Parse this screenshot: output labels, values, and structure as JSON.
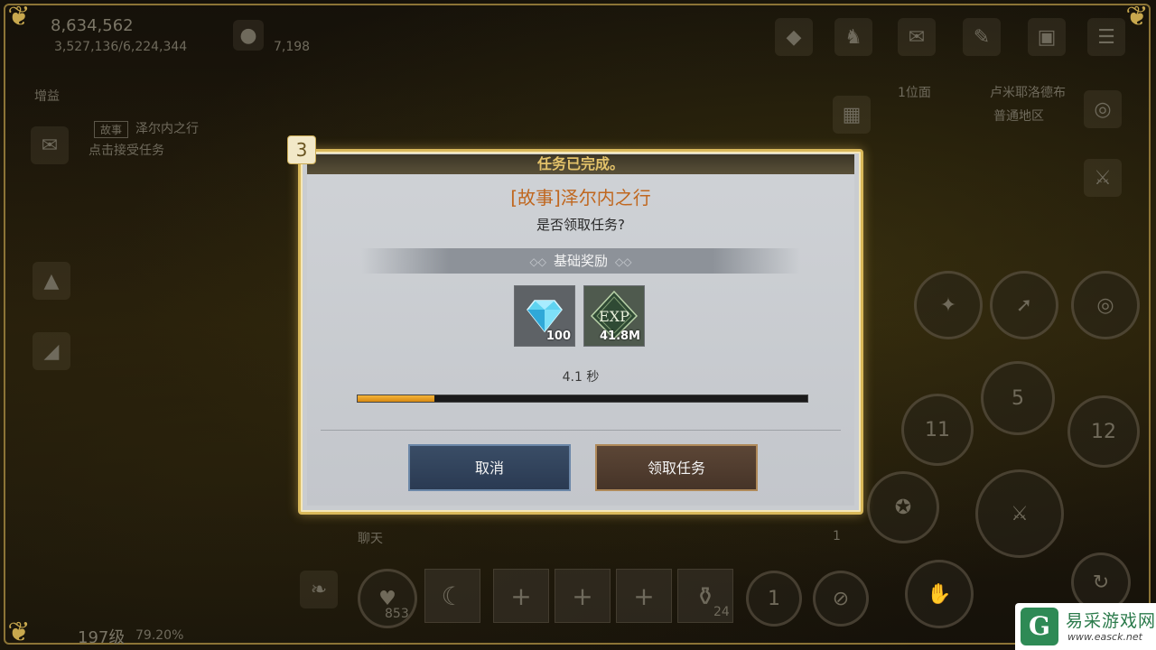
{
  "hud": {
    "power": "8,634,562",
    "exp": "3,527,136/6,224,344",
    "currency": "7,198",
    "buff_label": "增益",
    "quest_tag": "故事",
    "quest_name": "泽尔内之行",
    "quest_hint": "点击接受任务",
    "channel": "1位面",
    "location": "卢米耶洛德布",
    "area": "普通地区",
    "chat_label": "聊天",
    "level": "197级",
    "level_percent": "79.20%",
    "skill_numbers": [
      "5",
      "11",
      "12",
      "1",
      "1",
      "1"
    ],
    "slot_counts": [
      "853",
      "24"
    ]
  },
  "dialog": {
    "step": "3",
    "top_caption": "任务已完成。",
    "quest_title": "[故事]泽尔内之行",
    "question": "是否领取任务?",
    "reward_header": "基础奖励",
    "rewards": [
      {
        "icon": "diamond-icon",
        "qty": "100"
      },
      {
        "icon": "exp-icon",
        "label": "EXP",
        "qty": "41.8M"
      }
    ],
    "timer": "4.1 秒",
    "progress": 0.17,
    "cancel_label": "取消",
    "accept_label": "领取任务"
  },
  "watermark": {
    "logo": "G",
    "name": "易采游戏网",
    "url": "www.easck.net"
  },
  "colors": {
    "accent_gold": "#d9b85a",
    "title_orange": "#c0671f",
    "progress": "#f4b43a"
  }
}
